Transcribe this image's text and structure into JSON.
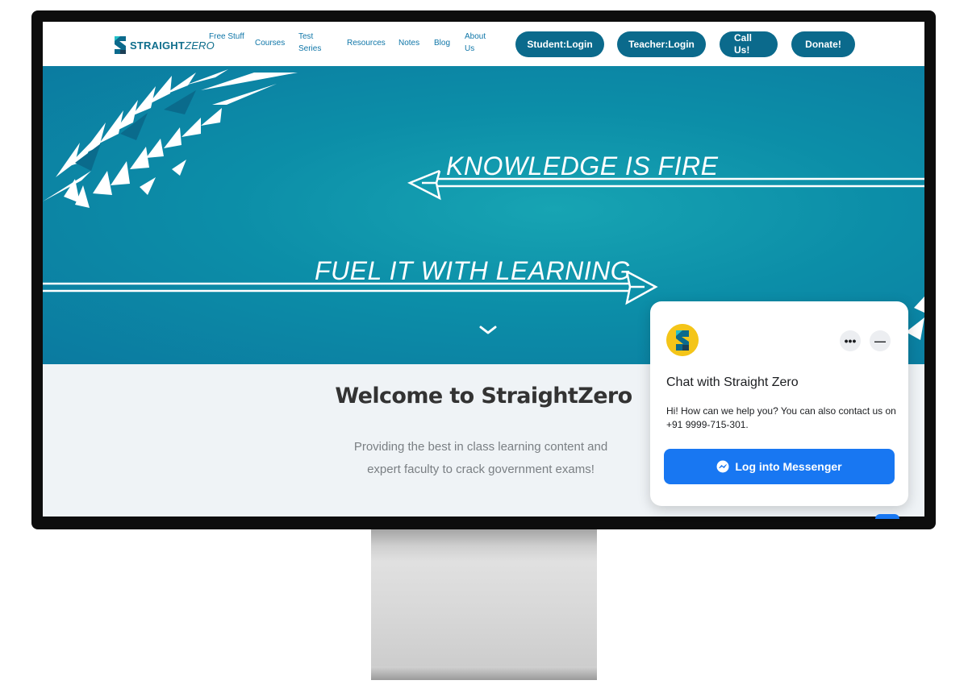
{
  "nav": {
    "logo_text_bold": "STRAIGHT",
    "logo_text_italic": "ZERO",
    "links": [
      "Free Stuff",
      "Courses",
      "Test Series",
      "Resources",
      "Notes",
      "Blog",
      "About Us"
    ],
    "buttons": [
      "Student:Login",
      "Teacher:Login",
      "Call Us!",
      "Donate!"
    ]
  },
  "hero": {
    "line1": "KNOWLEDGE IS FIRE",
    "line2": "FUEL IT WITH LEARNING",
    "scroll_icon": "chevron-down-icon"
  },
  "welcome": {
    "title": "Welcome to StraightZero",
    "subtitle": "Providing the best in class learning content and expert faculty to crack government exams!"
  },
  "chat": {
    "title": "Chat with Straight Zero",
    "message": "Hi! How can we help you? You can also contact us on +91 9999-715-301.",
    "button": "Log into Messenger",
    "more_icon": "more-icon",
    "minimize_icon": "minimize-icon"
  },
  "colors": {
    "brand": "#0b6a8c",
    "hero": "#0c8ea8",
    "messenger": "#1877f2",
    "link": "#0f76a8"
  }
}
